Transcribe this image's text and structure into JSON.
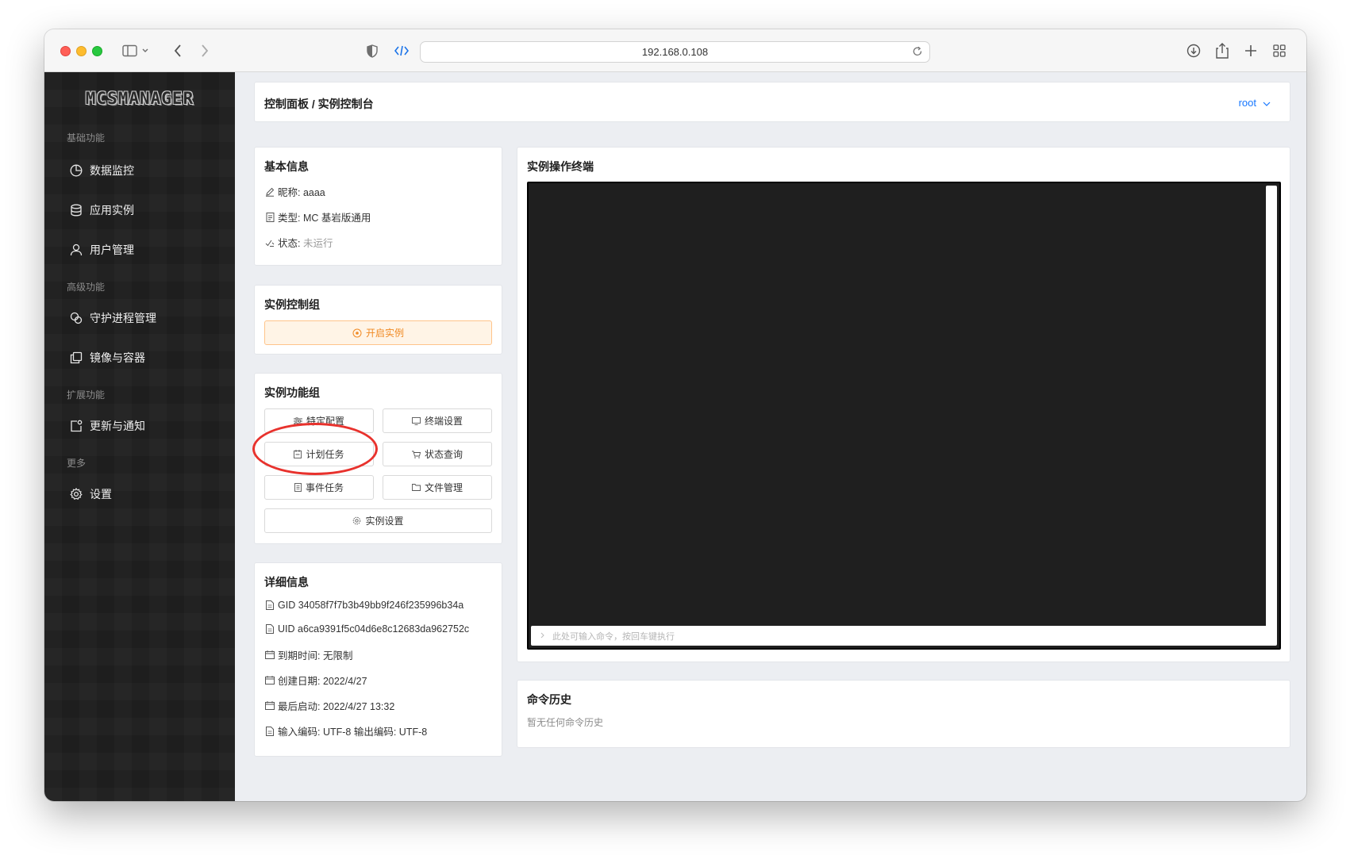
{
  "browser": {
    "url": "192.168.0.108"
  },
  "sidebar": {
    "logo": "MCSMANAGER",
    "sections": [
      {
        "title": "基础功能"
      },
      {
        "title": "高级功能"
      },
      {
        "title": "扩展功能"
      },
      {
        "title": "更多"
      }
    ],
    "items": [
      {
        "label": "数据监控",
        "icon": "pie-chart-icon"
      },
      {
        "label": "应用实例",
        "icon": "database-icon"
      },
      {
        "label": "用户管理",
        "icon": "user-icon"
      },
      {
        "label": "守护进程管理",
        "icon": "nodes-icon"
      },
      {
        "label": "镜像与容器",
        "icon": "copy-icon"
      },
      {
        "label": "更新与通知",
        "icon": "notification-icon"
      },
      {
        "label": "设置",
        "icon": "gear-icon"
      }
    ]
  },
  "header": {
    "breadcrumb": "控制面板 / 实例控制台",
    "user": "root"
  },
  "basic_info": {
    "title": "基本信息",
    "nickname": "昵称: aaaa",
    "type": "类型: MC 基岩版通用",
    "status_label": "状态: ",
    "status_value": "未运行"
  },
  "control_group": {
    "title": "实例控制组",
    "start_label": "开启实例"
  },
  "function_group": {
    "title": "实例功能组",
    "buttons": [
      {
        "label": "特定配置",
        "icon": "sliders-icon"
      },
      {
        "label": "终端设置",
        "icon": "monitor-icon"
      },
      {
        "label": "计划任务",
        "icon": "calendar-icon"
      },
      {
        "label": "状态查询",
        "icon": "cart-icon"
      },
      {
        "label": "事件任务",
        "icon": "file-icon"
      },
      {
        "label": "文件管理",
        "icon": "folder-icon"
      },
      {
        "label": "实例设置",
        "icon": "gear-icon"
      }
    ]
  },
  "details": {
    "title": "详细信息",
    "gid": "GID 34058f7f7b3b49bb9f246f235996b34a",
    "uid": "UID a6ca9391f5c04d6e8c12683da962752c",
    "expire": "到期时间: 无限制",
    "created": "创建日期: 2022/4/27",
    "last_start": "最后启动: 2022/4/27 13:32",
    "encoding": "输入编码: UTF-8 输出编码: UTF-8"
  },
  "terminal": {
    "title": "实例操作终端",
    "input_placeholder": "此处可输入命令，按回车键执行"
  },
  "history": {
    "title": "命令历史",
    "empty_text": "暂无任何命令历史"
  },
  "colors": {
    "accent": "#1677ff",
    "start_button": "#f08a24",
    "highlight": "#e8322d"
  }
}
